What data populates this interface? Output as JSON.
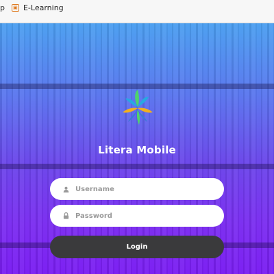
{
  "bookmarks_bar": {
    "partial_item": "p",
    "items": [
      {
        "label": "E-Learning",
        "icon": "school-favicon"
      }
    ]
  },
  "app": {
    "title": "Litera Mobile",
    "logo": "litera-logo-icon"
  },
  "login_form": {
    "username_placeholder": "Username",
    "username_value": "",
    "password_placeholder": "Password",
    "password_value": "",
    "login_label": "Login"
  },
  "colors": {
    "gradient_top": "#4a9ff0",
    "gradient_bottom": "#7a1cf2",
    "button_bg": "#3a3a3c",
    "field_bg": "#ffffff"
  }
}
